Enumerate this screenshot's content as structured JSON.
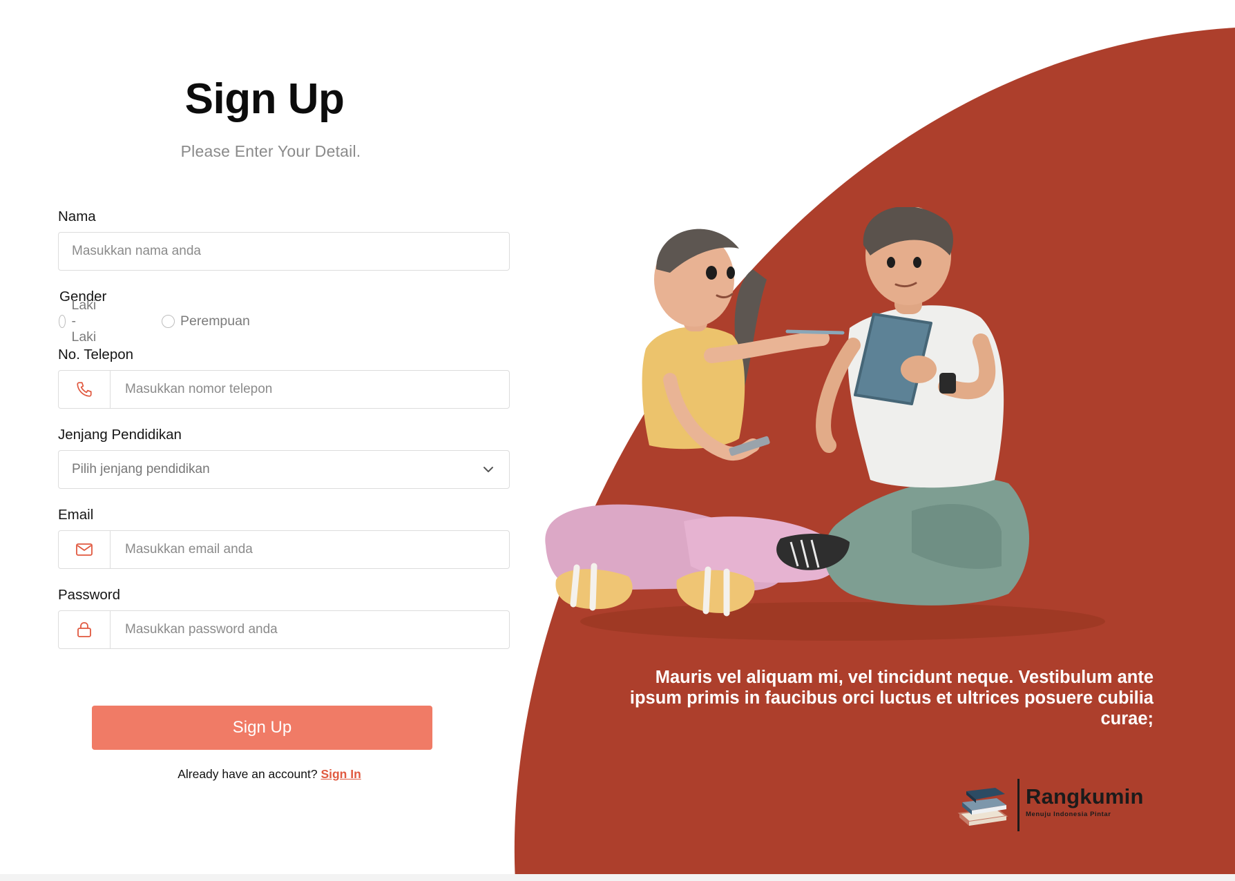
{
  "colors": {
    "accent": "#f07b66",
    "hero_background": "#ad3f2c",
    "link": "#e05a41",
    "icon": "#e0583f"
  },
  "form": {
    "title": "Sign Up",
    "subtitle": "Please Enter Your Detail.",
    "name": {
      "label": "Nama",
      "placeholder": "Masukkan nama anda",
      "value": ""
    },
    "gender": {
      "label": "Gender",
      "options": [
        {
          "label": "Laki - Laki",
          "selected": false
        },
        {
          "label": "Perempuan",
          "selected": false
        }
      ]
    },
    "phone": {
      "label": "No. Telepon",
      "placeholder": "Masukkan nomor telepon",
      "value": "",
      "icon": "phone-icon"
    },
    "education": {
      "label": "Jenjang Pendidikan",
      "placeholder": "Pilih jenjang pendidikan",
      "icon": "chevron-down-icon"
    },
    "email": {
      "label": "Email",
      "placeholder": "Masukkan email anda",
      "value": "",
      "icon": "mail-icon"
    },
    "password": {
      "label": "Password",
      "placeholder": "Masukkan password anda",
      "value": "",
      "icon": "lock-icon"
    },
    "submit_label": "Sign Up",
    "signin_prompt": "Already have an account?",
    "signin_link": "Sign In"
  },
  "hero": {
    "quote": "Mauris vel aliquam mi, vel tincidunt neque. Vestibulum ante ipsum primis in faucibus orci luctus et ultrices posuere cubilia curae;",
    "brand_name": "Rangkumin",
    "brand_tagline": "Menuju Indonesia Pintar"
  }
}
